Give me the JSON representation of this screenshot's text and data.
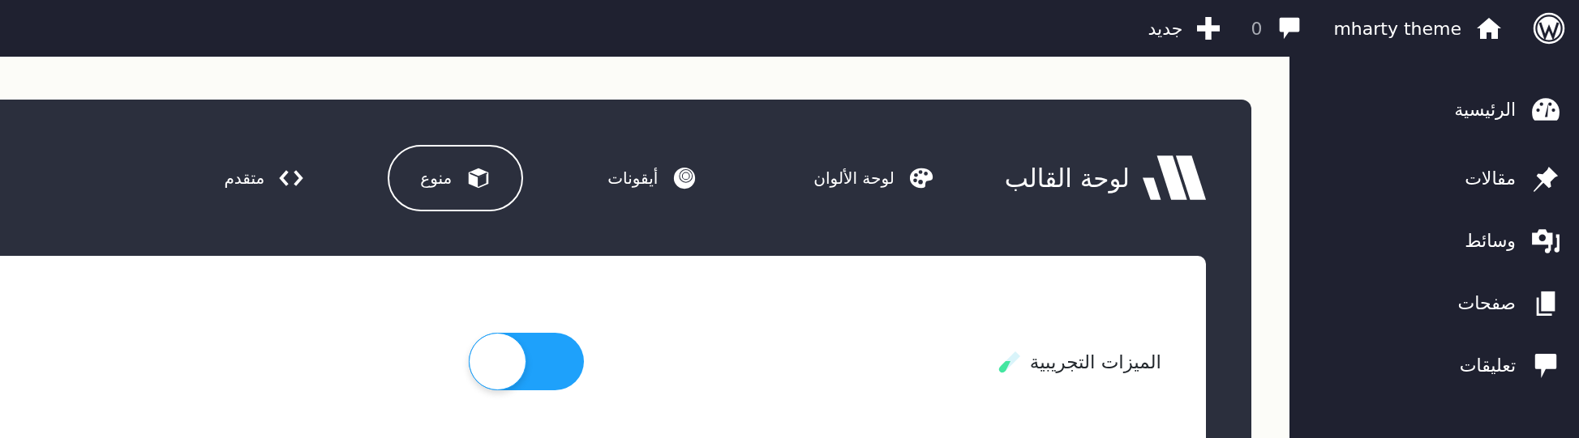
{
  "admin_bar": {
    "site_name": "mharty theme",
    "comments_count": "0",
    "new_label": "جديد"
  },
  "sidebar": {
    "items": [
      {
        "kind": "dashboard",
        "label": "الرئيسية"
      },
      {
        "kind": "posts",
        "label": "مقالات"
      },
      {
        "kind": "media",
        "label": "وسائط"
      },
      {
        "kind": "pages",
        "label": "صفحات"
      },
      {
        "kind": "comments",
        "label": "تعليقات"
      }
    ]
  },
  "panel": {
    "title": "لوحة القالب",
    "nav": [
      {
        "kind": "palette",
        "label": "لوحة الألوان",
        "selected": false
      },
      {
        "kind": "icons",
        "label": "أيقونات",
        "selected": false
      },
      {
        "kind": "misc",
        "label": "منوع",
        "selected": true
      },
      {
        "kind": "advanced",
        "label": "متقدم",
        "selected": false
      }
    ]
  },
  "settings": [
    {
      "label": "الميزات التجريبية",
      "on": true
    }
  ]
}
